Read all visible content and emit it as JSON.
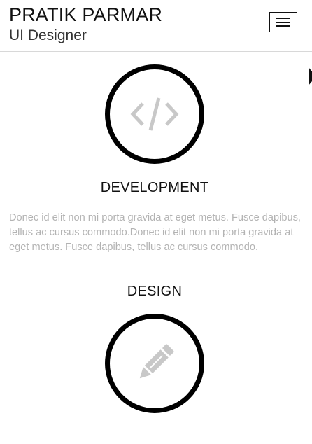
{
  "header": {
    "name": "PRATIK PARMAR",
    "role": "UI Designer",
    "menu_icon": "hamburger-menu-icon"
  },
  "sections": [
    {
      "icon": "code-icon",
      "title": "DEVELOPMENT",
      "text": "Donec id elit non mi porta gravida at eget metus. Fusce dapibus, tellus ac cursus commodo.Donec id elit non mi porta gravida at eget metus. Fusce dapibus, tellus ac cursus commodo."
    },
    {
      "icon": "pencil-icon",
      "title": "DESIGN"
    }
  ],
  "colors": {
    "text_dark": "#111111",
    "text_muted": "#b3b3b3",
    "icon_gray": "#c8c8c8",
    "circle_border": "#000000"
  }
}
